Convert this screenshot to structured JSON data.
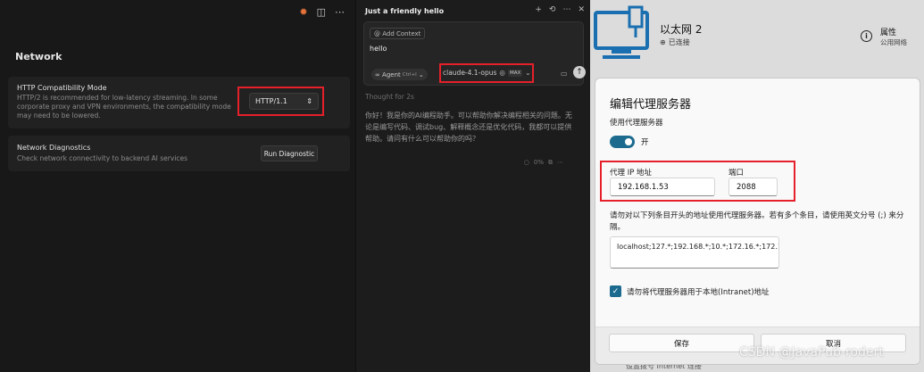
{
  "left": {
    "section_title": "Network",
    "http": {
      "title": "HTTP Compatibility Mode",
      "desc": "HTTP/2 is recommended for low-latency streaming. In some corporate proxy and VPN environments, the compatibility mode may need to be lowered.",
      "value": "HTTP/1.1"
    },
    "diag": {
      "title": "Network Diagnostics",
      "desc": "Check network connectivity to backend AI services",
      "button": "Run Diagnostic"
    }
  },
  "chat": {
    "title": "Just a friendly hello",
    "context_chip": "@ Add Context",
    "message": "hello",
    "agent_label": "∞ Agent",
    "agent_shortcut": "Ctrl+I",
    "model": "claude-4.1-opus",
    "max_badge": "MAX",
    "thought": "Thought for 2s",
    "answer": "你好！我是你的AI编程助手。可以帮助你解决编程相关的问题。无论是编写代码、调试bug、解释概念还是优化代码，我都可以提供帮助。请问有什么可以帮助你的吗？",
    "meta_percent": "0%"
  },
  "right": {
    "net_name": "以太网 2",
    "net_status": "已连接",
    "prop_title": "属性",
    "prop_sub": "公用网络",
    "bottom_text": "设置拨号 Internet 连接"
  },
  "dialog": {
    "title": "编辑代理服务器",
    "use_proxy": "使用代理服务器",
    "toggle_label": "开",
    "ip_label": "代理 IP 地址",
    "ip_value": "192.168.1.53",
    "port_label": "端口",
    "port_value": "2088",
    "exceptions_desc": "请勿对以下列条目开头的地址使用代理服务器。若有多个条目，请使用英文分号 (;) 来分隔。",
    "exceptions_value": "localhost;127.*;192.168.*;10.*;172.16.*;172.17.*;172.18.*;172.19.*;172.20.",
    "local_checkbox": "请勿将代理服务器用于本地(Intranet)地址",
    "save": "保存",
    "cancel": "取消"
  },
  "watermark": "CSDN @JavaPub-rodert",
  "colors": {
    "highlight": "#e5202a",
    "accent": "#1c6b8f",
    "network_icon": "#1a6fb0"
  }
}
